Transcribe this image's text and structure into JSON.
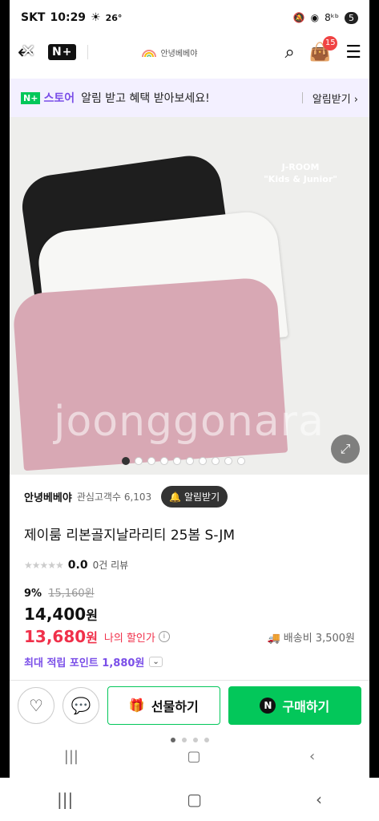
{
  "status": {
    "carrier": "SKT",
    "time": "10:29",
    "temp": "26°",
    "signal": "8ᵏᵇ",
    "battery": "5"
  },
  "header": {
    "brand": "N+",
    "shop_logo": "안녕베베야",
    "cart_count": "15"
  },
  "banner": {
    "brand": "N+",
    "store": "스토어",
    "message": "알림 받고 혜택 받아보세요!",
    "action": "알림받기 ›"
  },
  "photo": {
    "brand_line1": "J-ROOM",
    "brand_line2": "\"Kids & Junior\"",
    "watermark": "joonggonara",
    "slide_count": 10,
    "active_slide": 1
  },
  "store": {
    "name": "안녕베베야",
    "followers": "관심고객수 6,103",
    "alarm": "알림받기"
  },
  "product": {
    "title": "제이룸 리본골지날라리티 25봄 S-JM",
    "rating": "0.0",
    "reviews": "0건 리뷰",
    "discount_pct": "9%",
    "original_price": "15,160원",
    "price": "14,400",
    "sale_price": "13,680",
    "currency": "원",
    "my_discount": "나의 할인가",
    "shipping": "배송비 3,500원",
    "points": "최대 적립 포인트 1,880원"
  },
  "actions": {
    "gift": "선물하기",
    "buy": "구매하기",
    "buy_badge": "N"
  }
}
